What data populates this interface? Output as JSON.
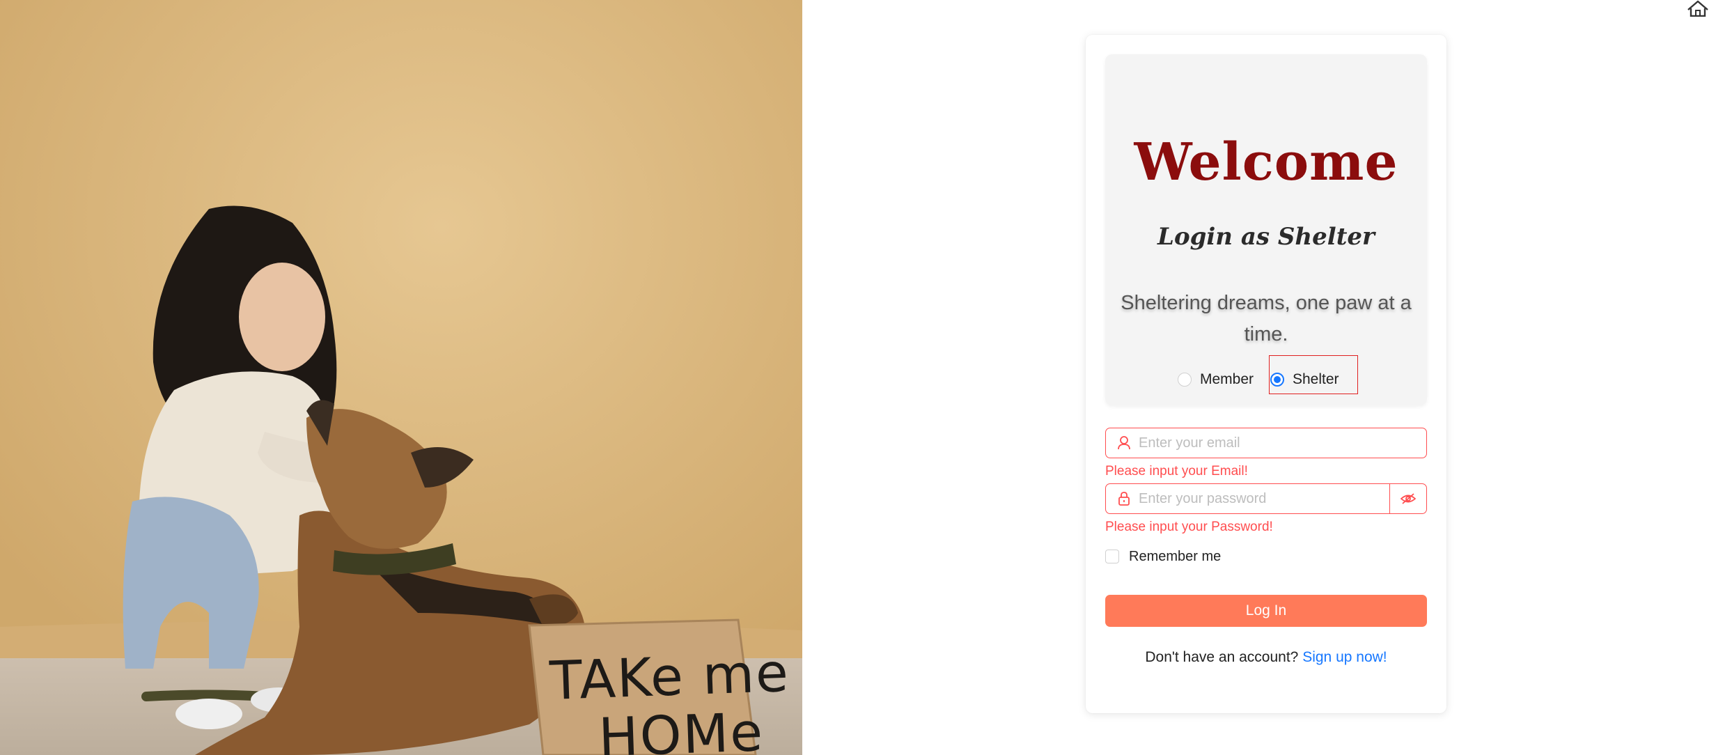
{
  "hero": {
    "welcome": "Welcome",
    "login_as": "Login as Shelter",
    "tagline": "Sheltering dreams, one paw at a time."
  },
  "role": {
    "options": [
      {
        "label": "Member",
        "checked": false
      },
      {
        "label": "Shelter",
        "checked": true
      }
    ],
    "selected": "Shelter"
  },
  "form": {
    "email": {
      "placeholder": "Enter your email",
      "value": "",
      "error": "Please input your Email!"
    },
    "password": {
      "placeholder": "Enter your password",
      "value": "",
      "error": "Please input your Password!"
    },
    "remember_label": "Remember me",
    "remember_checked": false,
    "submit_label": "Log In"
  },
  "footer": {
    "prompt": "Don't have an account?",
    "link_label": "Sign up now!"
  },
  "photo": {
    "sign_lines": [
      "TAKe me",
      "HOMe"
    ]
  },
  "icons": {
    "home": "home-icon",
    "user": "user-icon",
    "lock": "lock-icon",
    "eye": "eye-invisible-icon"
  },
  "colors": {
    "welcome": "#8b0d0d",
    "error": "#ff4d4f",
    "primary_button": "#ff7a59",
    "link": "#1677ff",
    "radio_selected": "#1677ff"
  }
}
